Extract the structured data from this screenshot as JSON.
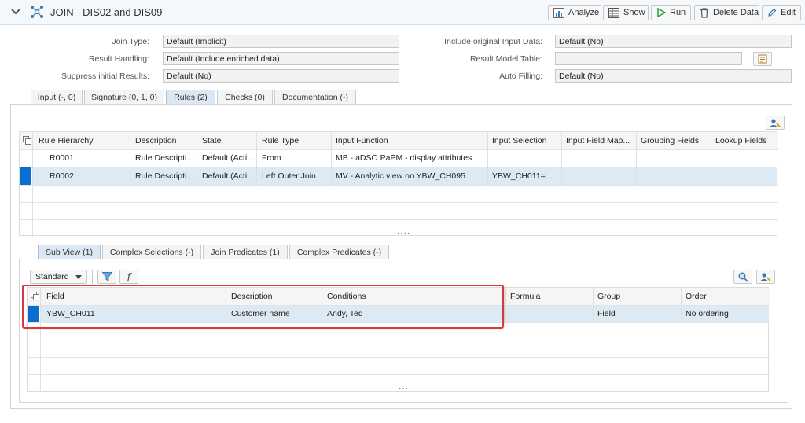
{
  "header": {
    "title": "JOIN - DIS02 and DIS09",
    "buttons": {
      "analyze": "Analyze",
      "show": "Show",
      "run": "Run",
      "delete_data": "Delete Data",
      "edit": "Edit"
    }
  },
  "form": {
    "join_type": {
      "label": "Join Type:",
      "value": "Default (Implicit)"
    },
    "result_handling": {
      "label": "Result Handling:",
      "value": "Default (Include enriched data)"
    },
    "suppress_initial": {
      "label": "Suppress initial Results:",
      "value": "Default (No)"
    },
    "include_original": {
      "label": "Include original Input Data:",
      "value": "Default (No)"
    },
    "result_model_table": {
      "label": "Result Model Table:",
      "value": ""
    },
    "auto_filling": {
      "label": "Auto Filling:",
      "value": "Default (No)"
    }
  },
  "tabs": [
    {
      "label": "Input (-, 0)",
      "active": false
    },
    {
      "label": "Signature (0, 1, 0)",
      "active": false
    },
    {
      "label": "Rules (2)",
      "active": true
    },
    {
      "label": "Checks (0)",
      "active": false
    },
    {
      "label": "Documentation (-)",
      "active": false
    }
  ],
  "rules_table": {
    "columns": [
      "Rule Hierarchy",
      "Description",
      "State",
      "Rule Type",
      "Input Function",
      "Input Selection",
      "Input Field Map...",
      "Grouping Fields",
      "Lookup Fields"
    ],
    "rows": [
      [
        "R0001",
        "Rule Descripti...",
        "Default (Acti...",
        "From",
        "MB - aDSO PaPM - display attributes",
        "",
        "",
        "",
        ""
      ],
      [
        "R0002",
        "Rule Descripti...",
        "Default (Acti...",
        "Left Outer Join",
        "MV - Analytic view on YBW_CH095",
        "YBW_CH011=...",
        "",
        "",
        ""
      ]
    ],
    "selected_row": 1
  },
  "sub_tabs": [
    {
      "label": "Sub View (1)",
      "active": true
    },
    {
      "label": "Complex Selections (-)",
      "active": false
    },
    {
      "label": "Join Predicates (1)",
      "active": false
    },
    {
      "label": "Complex Predicates (-)",
      "active": false
    }
  ],
  "subview_toolbar": {
    "variant": "Standard",
    "function_symbol": "f"
  },
  "subview_table": {
    "columns": [
      "Field",
      "Description",
      "Conditions",
      "Formula",
      "Group",
      "Order"
    ],
    "rows": [
      [
        "YBW_CH011",
        "Customer name",
        "Andy, Ted",
        "",
        "Field",
        "No ordering"
      ]
    ],
    "selected_row": 0
  },
  "colors": {
    "accent": "#0a6ed1",
    "selected_row": "#dde9f3",
    "highlight_box": "#d9383a",
    "active_tab": "#dbe8f4"
  }
}
